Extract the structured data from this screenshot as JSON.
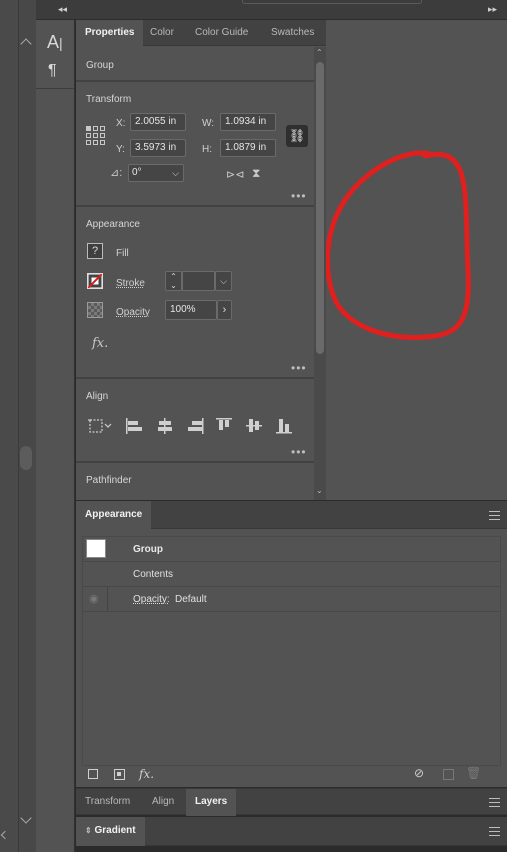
{
  "tools": {
    "type_tool": "A",
    "paragraph_tool": "¶"
  },
  "properties_panel": {
    "tabs": [
      "Properties",
      "Color",
      "Color Guide",
      "Swatches"
    ],
    "active_tab": "Properties",
    "selection_label": "Group",
    "transform": {
      "title": "Transform",
      "x_label": "X:",
      "x_value": "2.0055 in",
      "y_label": "Y:",
      "y_value": "3.5973 in",
      "w_label": "W:",
      "w_value": "1.0934 in",
      "h_label": "H:",
      "h_value": "1.0879 in",
      "angle_value": "0°"
    },
    "appearance": {
      "title": "Appearance",
      "fill_label": "Fill",
      "stroke_label": "Stroke",
      "opacity_label": "Opacity",
      "opacity_value": "100%",
      "fx_label": "fx."
    },
    "align": {
      "title": "Align"
    },
    "pathfinder": {
      "title": "Pathfinder"
    }
  },
  "appearance_panel": {
    "tab": "Appearance",
    "rows": [
      {
        "label": "Group"
      },
      {
        "label": "Contents"
      },
      {
        "label": "Opacity:",
        "value": "Default"
      }
    ],
    "fx_label": "fx."
  },
  "bottom_tabs": {
    "tabs": [
      "Transform",
      "Align",
      "Layers"
    ],
    "active_tab": "Layers"
  },
  "gradient_panel": {
    "tab": "Gradient"
  },
  "colors": {
    "panel_bg": "#535353",
    "tab_bg": "#424242",
    "canvas_bg": "#535353",
    "stroke_red": "#e01f1f"
  }
}
